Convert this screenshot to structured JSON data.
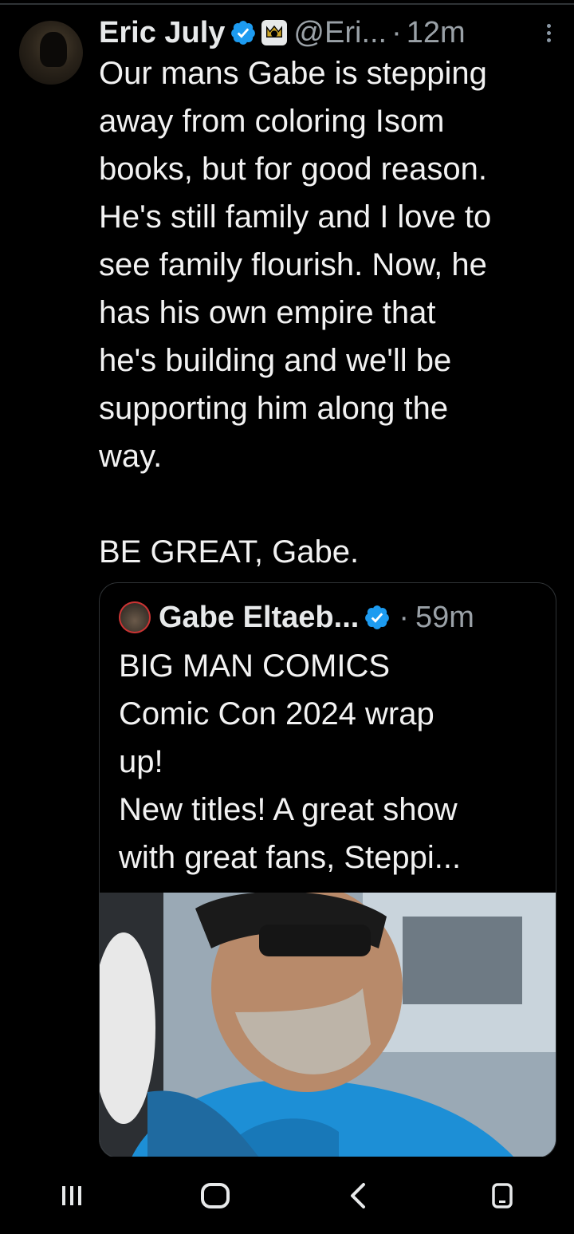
{
  "tweet": {
    "author_name": "Eric July",
    "handle": "@Eri...",
    "separator": "·",
    "time": "12m",
    "lines": [
      "Our mans Gabe is stepping",
      "away from coloring Isom",
      "books, but for good reason.",
      "He's still family and I love to",
      "see family flourish. Now, he",
      "has his own empire that",
      "he's building and we'll be",
      "supporting him along the",
      "way."
    ],
    "closing_line": "BE GREAT, Gabe."
  },
  "quote": {
    "author_name": "Gabe Eltaeb...",
    "separator": "·",
    "time": "59m",
    "lines": [
      "BIG MAN COMICS",
      "Comic Con 2024 wrap",
      "up!",
      "New titles! A great show",
      "with great fans, Steppi..."
    ]
  },
  "colors": {
    "background": "#000000",
    "text": "#e7e9ea",
    "muted": "#9aa1a7",
    "verified_blue": "#1d9bf0",
    "border": "#2f3336"
  },
  "icons": {
    "verified": "verified-badge-icon",
    "affiliation": "affiliate-badge-icon",
    "more": "more-vertical-icon",
    "nav_recents": "recents-icon",
    "nav_home": "home-icon",
    "nav_back": "back-icon",
    "nav_rotate": "rotate-icon"
  }
}
